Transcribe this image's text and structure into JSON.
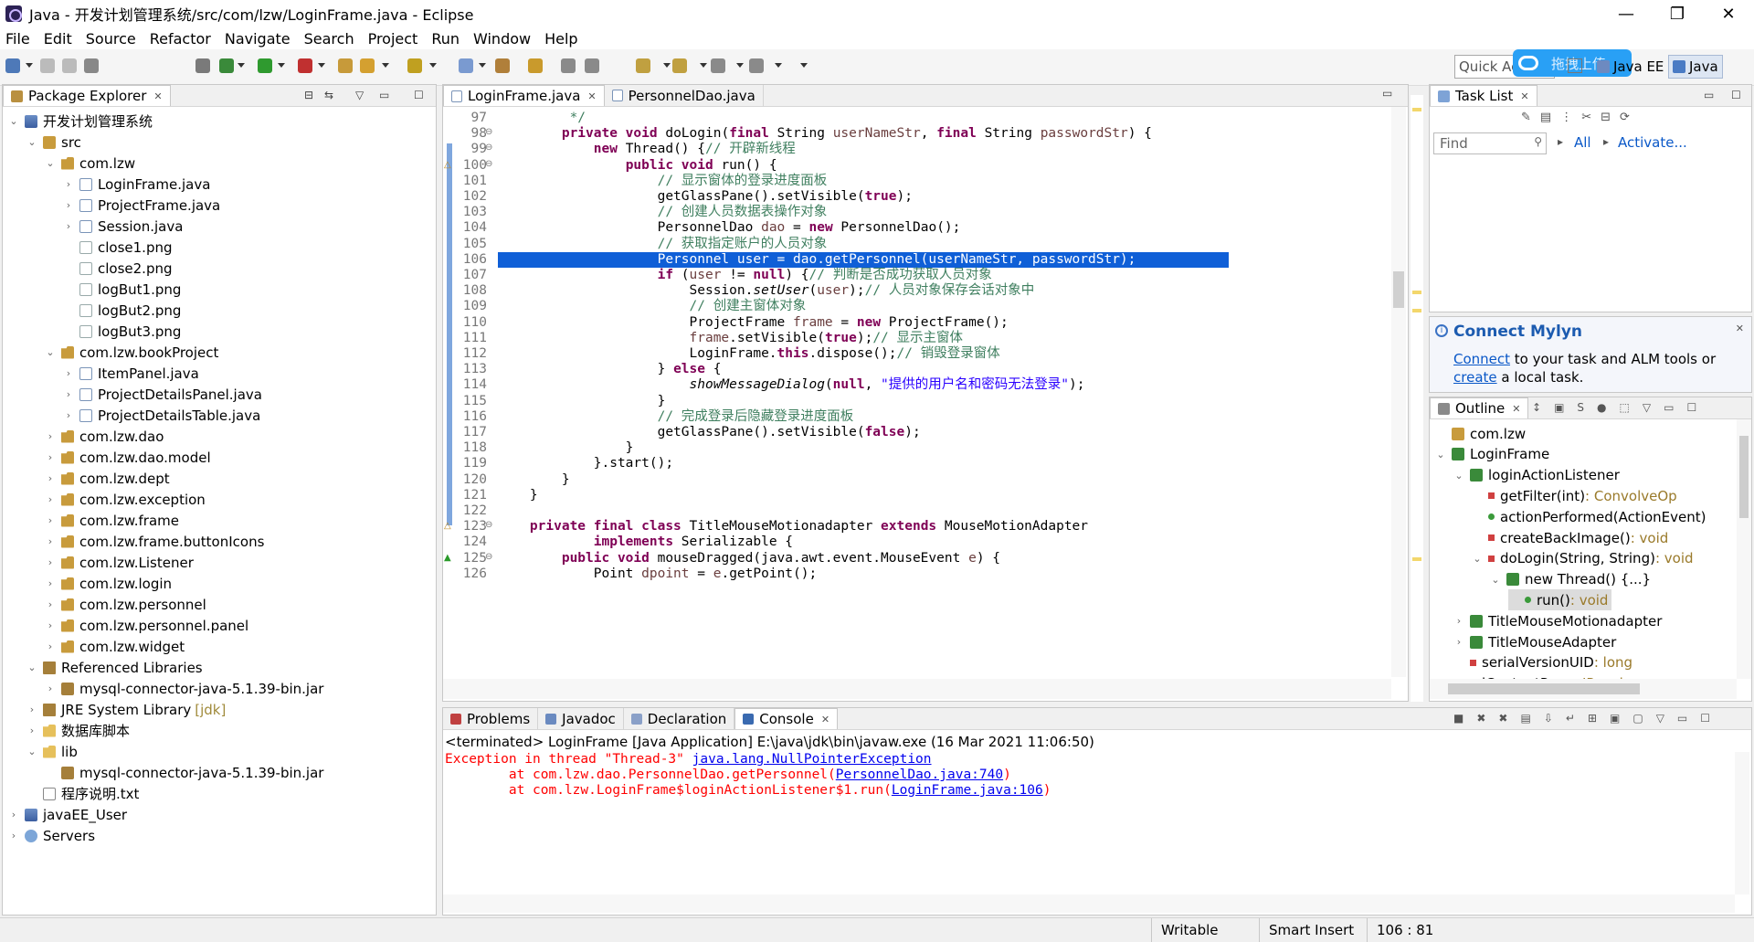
{
  "window": {
    "title": "Java - 开发计划管理系统/src/com/lzw/LoginFrame.java - Eclipse",
    "minimize": "—",
    "maximize": "❐",
    "close": "✕"
  },
  "menu": [
    "File",
    "Edit",
    "Source",
    "Refactor",
    "Navigate",
    "Search",
    "Project",
    "Run",
    "Window",
    "Help"
  ],
  "quick_access": {
    "placeholder": "Quick Access"
  },
  "upload_badge": "拖拽上传",
  "perspectives": [
    "Java EE",
    "Java"
  ],
  "package_explorer": {
    "tab": "Package Explorer",
    "rows": [
      {
        "label": "开发计划管理系统",
        "indent": 0,
        "tw": "⌄",
        "icon": "proj"
      },
      {
        "label": "src",
        "indent": 1,
        "tw": "⌄",
        "icon": "src"
      },
      {
        "label": "com.lzw",
        "indent": 2,
        "tw": "⌄",
        "icon": "pkg"
      },
      {
        "label": "LoginFrame.java",
        "indent": 3,
        "tw": "›",
        "icon": "java"
      },
      {
        "label": "ProjectFrame.java",
        "indent": 3,
        "tw": "›",
        "icon": "java"
      },
      {
        "label": "Session.java",
        "indent": 3,
        "tw": "›",
        "icon": "java"
      },
      {
        "label": "close1.png",
        "indent": 3,
        "tw": "",
        "icon": "png"
      },
      {
        "label": "close2.png",
        "indent": 3,
        "tw": "",
        "icon": "png"
      },
      {
        "label": "logBut1.png",
        "indent": 3,
        "tw": "",
        "icon": "png"
      },
      {
        "label": "logBut2.png",
        "indent": 3,
        "tw": "",
        "icon": "png"
      },
      {
        "label": "logBut3.png",
        "indent": 3,
        "tw": "",
        "icon": "png"
      },
      {
        "label": "com.lzw.bookProject",
        "indent": 2,
        "tw": "⌄",
        "icon": "pkg"
      },
      {
        "label": "ItemPanel.java",
        "indent": 3,
        "tw": "›",
        "icon": "java"
      },
      {
        "label": "ProjectDetailsPanel.java",
        "indent": 3,
        "tw": "›",
        "icon": "java"
      },
      {
        "label": "ProjectDetailsTable.java",
        "indent": 3,
        "tw": "›",
        "icon": "java"
      },
      {
        "label": "com.lzw.dao",
        "indent": 2,
        "tw": "›",
        "icon": "pkg"
      },
      {
        "label": "com.lzw.dao.model",
        "indent": 2,
        "tw": "›",
        "icon": "pkg"
      },
      {
        "label": "com.lzw.dept",
        "indent": 2,
        "tw": "›",
        "icon": "pkg"
      },
      {
        "label": "com.lzw.exception",
        "indent": 2,
        "tw": "›",
        "icon": "pkg"
      },
      {
        "label": "com.lzw.frame",
        "indent": 2,
        "tw": "›",
        "icon": "pkg"
      },
      {
        "label": "com.lzw.frame.buttonIcons",
        "indent": 2,
        "tw": "›",
        "icon": "pkg"
      },
      {
        "label": "com.lzw.Listener",
        "indent": 2,
        "tw": "›",
        "icon": "pkg"
      },
      {
        "label": "com.lzw.login",
        "indent": 2,
        "tw": "›",
        "icon": "pkg"
      },
      {
        "label": "com.lzw.personnel",
        "indent": 2,
        "tw": "›",
        "icon": "pkg"
      },
      {
        "label": "com.lzw.personnel.panel",
        "indent": 2,
        "tw": "›",
        "icon": "pkg"
      },
      {
        "label": "com.lzw.widget",
        "indent": 2,
        "tw": "›",
        "icon": "pkg"
      },
      {
        "label": "Referenced Libraries",
        "indent": 1,
        "tw": "⌄",
        "icon": "lib"
      },
      {
        "label": "mysql-connector-java-5.1.39-bin.jar",
        "indent": 2,
        "tw": "›",
        "icon": "jar"
      },
      {
        "label": "JRE System Library",
        "suffix": "[jdk]",
        "indent": 1,
        "tw": "›",
        "icon": "lib"
      },
      {
        "label": "数据库脚本",
        "indent": 1,
        "tw": "›",
        "icon": "fold"
      },
      {
        "label": "lib",
        "indent": 1,
        "tw": "⌄",
        "icon": "fold"
      },
      {
        "label": "mysql-connector-java-5.1.39-bin.jar",
        "indent": 2,
        "tw": "",
        "icon": "jar"
      },
      {
        "label": "程序说明.txt",
        "indent": 1,
        "tw": "",
        "icon": "txt"
      },
      {
        "label": "javaEE_User",
        "indent": 0,
        "tw": "›",
        "icon": "proj"
      },
      {
        "label": "Servers",
        "indent": 0,
        "tw": "›",
        "icon": "srv"
      }
    ]
  },
  "editor": {
    "tabs": [
      "LoginFrame.java",
      "PersonnelDao.java"
    ],
    "highlight_line": "106",
    "lines": [
      {
        "n": "97",
        "parts": [
          {
            "t": "         */",
            "c": "cm"
          }
        ]
      },
      {
        "n": "98",
        "fold": "⊖",
        "parts": [
          {
            "t": "        "
          },
          {
            "t": "private void",
            "c": "kw"
          },
          {
            "t": " doLogin("
          },
          {
            "t": "final",
            "c": "kw"
          },
          {
            "t": " String "
          },
          {
            "t": "userNameStr",
            "c": "var"
          },
          {
            "t": ", "
          },
          {
            "t": "final",
            "c": "kw"
          },
          {
            "t": " String "
          },
          {
            "t": "passwordStr",
            "c": "var"
          },
          {
            "t": ") {"
          }
        ]
      },
      {
        "n": "99",
        "fold": "⊖",
        "parts": [
          {
            "t": "            "
          },
          {
            "t": "new",
            "c": "kw"
          },
          {
            "t": " Thread() {"
          },
          {
            "t": "// 开辟新线程",
            "c": "cm"
          }
        ]
      },
      {
        "n": "100",
        "fold": "⊖",
        "mark": "△",
        "parts": [
          {
            "t": "                "
          },
          {
            "t": "public void",
            "c": "kw"
          },
          {
            "t": " run() {"
          }
        ]
      },
      {
        "n": "101",
        "parts": [
          {
            "t": "                    "
          },
          {
            "t": "// 显示窗体的登录进度面板",
            "c": "cm"
          }
        ]
      },
      {
        "n": "102",
        "parts": [
          {
            "t": "                    getGlassPane().setVisible("
          },
          {
            "t": "true",
            "c": "kw"
          },
          {
            "t": ");"
          }
        ]
      },
      {
        "n": "103",
        "parts": [
          {
            "t": "                    "
          },
          {
            "t": "// 创建人员数据表操作对象",
            "c": "cm"
          }
        ]
      },
      {
        "n": "104",
        "parts": [
          {
            "t": "                    PersonnelDao "
          },
          {
            "t": "dao",
            "c": "var"
          },
          {
            "t": " = "
          },
          {
            "t": "new",
            "c": "kw"
          },
          {
            "t": " PersonnelDao();"
          }
        ]
      },
      {
        "n": "105",
        "parts": [
          {
            "t": "                    "
          },
          {
            "t": "// 获取指定账户的人员对象",
            "c": "cm"
          }
        ]
      },
      {
        "n": "106",
        "parts": [
          {
            "t": "                    Personnel user = dao.getPersonnel(userNameStr, passwordStr);"
          }
        ]
      },
      {
        "n": "107",
        "parts": [
          {
            "t": "                    "
          },
          {
            "t": "if",
            "c": "kw"
          },
          {
            "t": " ("
          },
          {
            "t": "user",
            "c": "var"
          },
          {
            "t": " != "
          },
          {
            "t": "null",
            "c": "kw"
          },
          {
            "t": ") {"
          },
          {
            "t": "// 判断是否成功获取人员对象",
            "c": "cm"
          }
        ]
      },
      {
        "n": "108",
        "parts": [
          {
            "t": "                        Session."
          },
          {
            "t": "setUser",
            "c": "it"
          },
          {
            "t": "("
          },
          {
            "t": "user",
            "c": "var"
          },
          {
            "t": ");"
          },
          {
            "t": "// 人员对象保存会话对象中",
            "c": "cm"
          }
        ]
      },
      {
        "n": "109",
        "parts": [
          {
            "t": "                        "
          },
          {
            "t": "// 创建主窗体对象",
            "c": "cm"
          }
        ]
      },
      {
        "n": "110",
        "parts": [
          {
            "t": "                        ProjectFrame "
          },
          {
            "t": "frame",
            "c": "var"
          },
          {
            "t": " = "
          },
          {
            "t": "new",
            "c": "kw"
          },
          {
            "t": " ProjectFrame();"
          }
        ]
      },
      {
        "n": "111",
        "parts": [
          {
            "t": "                        "
          },
          {
            "t": "frame",
            "c": "var"
          },
          {
            "t": ".setVisible("
          },
          {
            "t": "true",
            "c": "kw"
          },
          {
            "t": ");"
          },
          {
            "t": "// 显示主窗体",
            "c": "cm"
          }
        ]
      },
      {
        "n": "112",
        "parts": [
          {
            "t": "                        LoginFrame."
          },
          {
            "t": "this",
            "c": "kw"
          },
          {
            "t": ".dispose();"
          },
          {
            "t": "// 销毁登录窗体",
            "c": "cm"
          }
        ]
      },
      {
        "n": "113",
        "parts": [
          {
            "t": "                    } "
          },
          {
            "t": "else",
            "c": "kw"
          },
          {
            "t": " {"
          }
        ]
      },
      {
        "n": "114",
        "parts": [
          {
            "t": "                        "
          },
          {
            "t": "showMessageDialog",
            "c": "it"
          },
          {
            "t": "("
          },
          {
            "t": "null",
            "c": "kw"
          },
          {
            "t": ", "
          },
          {
            "t": "\"提供的用户名和密码无法登录\"",
            "c": "str"
          },
          {
            "t": ");"
          }
        ]
      },
      {
        "n": "115",
        "parts": [
          {
            "t": "                    }"
          }
        ]
      },
      {
        "n": "116",
        "parts": [
          {
            "t": "                    "
          },
          {
            "t": "// 完成登录后隐藏登录进度面板",
            "c": "cm"
          }
        ]
      },
      {
        "n": "117",
        "parts": [
          {
            "t": "                    getGlassPane().setVisible("
          },
          {
            "t": "false",
            "c": "kw"
          },
          {
            "t": ");"
          }
        ]
      },
      {
        "n": "118",
        "parts": [
          {
            "t": "                }"
          }
        ]
      },
      {
        "n": "119",
        "parts": [
          {
            "t": "            }.start();"
          }
        ]
      },
      {
        "n": "120",
        "parts": [
          {
            "t": "        }"
          }
        ]
      },
      {
        "n": "121",
        "parts": [
          {
            "t": "    }"
          }
        ]
      },
      {
        "n": "122",
        "parts": [
          {
            "t": ""
          }
        ]
      },
      {
        "n": "123",
        "fold": "⊖",
        "mark": "△",
        "parts": [
          {
            "t": "    "
          },
          {
            "t": "private final class",
            "c": "kw"
          },
          {
            "t": " TitleMouseMotionadapter "
          },
          {
            "t": "extends",
            "c": "kw"
          },
          {
            "t": " MouseMotionAdapter"
          }
        ]
      },
      {
        "n": "124",
        "parts": [
          {
            "t": "            "
          },
          {
            "t": "implements",
            "c": "kw"
          },
          {
            "t": " Serializable {"
          }
        ]
      },
      {
        "n": "125",
        "fold": "⊖",
        "mark": "▲",
        "parts": [
          {
            "t": "        "
          },
          {
            "t": "public void",
            "c": "kw"
          },
          {
            "t": " mouseDragged(java.awt.event.MouseEvent "
          },
          {
            "t": "e",
            "c": "var"
          },
          {
            "t": ") {"
          }
        ]
      },
      {
        "n": "126",
        "parts": [
          {
            "t": "            Point "
          },
          {
            "t": "dpoint",
            "c": "var"
          },
          {
            "t": " = "
          },
          {
            "t": "e",
            "c": "var"
          },
          {
            "t": ".getPoint();"
          }
        ]
      }
    ]
  },
  "task_list": {
    "tab": "Task List",
    "find_placeholder": "Find",
    "all": "All",
    "activate": "Activate..."
  },
  "mylyn": {
    "title": "Connect Mylyn",
    "connect": "Connect",
    "text1": " to your task and ALM tools or",
    "create": "create",
    "text2": " a local task."
  },
  "outline": {
    "tab": "Outline",
    "rows": [
      {
        "label": "com.lzw",
        "indent": 0,
        "tw": "",
        "icon": "pkg",
        "sel": false
      },
      {
        "label": "LoginFrame",
        "indent": 0,
        "tw": "⌄",
        "icon": "cls",
        "sel": false
      },
      {
        "label": "loginActionListener",
        "indent": 1,
        "tw": "⌄",
        "icon": "cls",
        "sel": false
      },
      {
        "label": "getFilter(int)",
        "ret": " : ConvolveOp",
        "indent": 2,
        "tw": "",
        "icon": "priv",
        "sel": false
      },
      {
        "label": "actionPerformed(ActionEvent)",
        "ret": "",
        "indent": 2,
        "tw": "",
        "icon": "pub",
        "sel": false
      },
      {
        "label": "createBackImage()",
        "ret": " : void",
        "indent": 2,
        "tw": "",
        "icon": "priv",
        "sel": false
      },
      {
        "label": "doLogin(String, String)",
        "ret": " : void",
        "indent": 2,
        "tw": "⌄",
        "icon": "priv",
        "sel": false
      },
      {
        "label": "new Thread() {...}",
        "ret": "",
        "indent": 3,
        "tw": "⌄",
        "icon": "anon",
        "sel": false
      },
      {
        "label": "run()",
        "ret": " : void",
        "indent": 4,
        "tw": "",
        "icon": "pub",
        "sel": true
      },
      {
        "label": "TitleMouseMotionadapter",
        "ret": "",
        "indent": 1,
        "tw": "›",
        "icon": "cls",
        "sel": false
      },
      {
        "label": "TitleMouseAdapter",
        "ret": "",
        "indent": 1,
        "tw": "›",
        "icon": "cls",
        "sel": false
      },
      {
        "label": "serialVersionUID",
        "ret": " : long",
        "indent": 1,
        "tw": "",
        "icon": "priv",
        "sel": false
      },
      {
        "label": "iContentPane",
        "ret": " : JPanel",
        "indent": 1,
        "tw": "",
        "icon": "priv",
        "sel": false
      }
    ]
  },
  "bottom": {
    "tabs": [
      "Problems",
      "Javadoc",
      "Declaration",
      "Console"
    ],
    "terminated": "<terminated> LoginFrame [Java Application] E:\\java\\jdk\\bin\\javaw.exe (16 Mar 2021 11:06:50)",
    "lines": [
      {
        "parts": [
          {
            "t": "Exception in thread \"Thread-3\" ",
            "c": "err"
          },
          {
            "t": "java.lang.NullPointerException",
            "c": "link"
          }
        ]
      },
      {
        "parts": [
          {
            "t": "\tat com.lzw.dao.PersonnelDao.getPersonnel(",
            "c": "err"
          },
          {
            "t": "PersonnelDao.java:740",
            "c": "link"
          },
          {
            "t": ")",
            "c": "err"
          }
        ]
      },
      {
        "parts": [
          {
            "t": "\tat com.lzw.LoginFrame$loginActionListener$1.run(",
            "c": "err"
          },
          {
            "t": "LoginFrame.java:106",
            "c": "link"
          },
          {
            "t": ")",
            "c": "err"
          }
        ]
      }
    ]
  },
  "status": {
    "writable": "Writable",
    "insert": "Smart Insert",
    "position": "106 : 81"
  },
  "colors": {
    "selection": "#0f5fd7",
    "console_error": "#ff0000",
    "link": "#0000ee"
  }
}
